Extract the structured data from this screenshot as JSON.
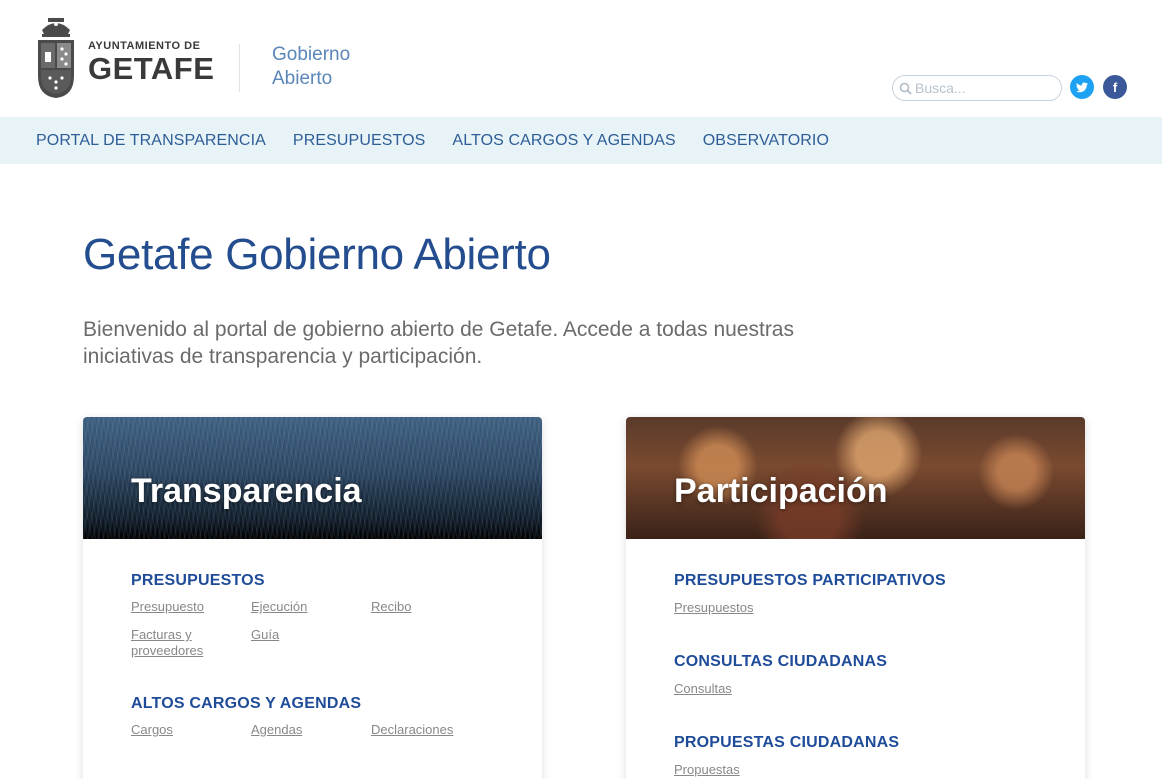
{
  "header": {
    "logo_small": "AYUNTAMIENTO DE",
    "logo_big": "GETAFE",
    "site_name_line1": "Gobierno",
    "site_name_line2": "Abierto",
    "search_placeholder": "Busca...",
    "twitter_glyph": "t",
    "facebook_glyph": "f"
  },
  "nav": {
    "items": [
      {
        "label": "PORTAL DE TRANSPARENCIA"
      },
      {
        "label": "PRESUPUESTOS"
      },
      {
        "label": "ALTOS CARGOS Y AGENDAS"
      },
      {
        "label": "OBSERVATORIO"
      }
    ]
  },
  "main": {
    "title": "Getafe Gobierno Abierto",
    "intro": "Bienvenido al portal de gobierno abierto de Getafe. Accede a todas nuestras iniciativas de transparencia y participación."
  },
  "cards": {
    "transparencia": {
      "title": "Transparencia",
      "sections": [
        {
          "title": "PRESUPUESTOS",
          "links": [
            "Presupuesto",
            "Ejecución",
            "Recibo",
            "Facturas y proveedores",
            "Guía"
          ]
        },
        {
          "title": "ALTOS CARGOS Y AGENDAS",
          "links": [
            "Cargos",
            "Agendas",
            "Declaraciones"
          ]
        }
      ]
    },
    "participacion": {
      "title": "Participación",
      "sections": [
        {
          "title": "PRESUPUESTOS PARTICIPATIVOS",
          "links": [
            "Presupuestos"
          ]
        },
        {
          "title": "CONSULTAS CIUDADANAS",
          "links": [
            "Consultas"
          ]
        },
        {
          "title": "PROPUESTAS CIUDADANAS",
          "links": [
            "Propuestas"
          ]
        }
      ]
    }
  },
  "colors": {
    "primary": "#234d8e",
    "nav_bg": "#e8f3f8",
    "twitter": "#1da1f2",
    "facebook": "#3b5998"
  }
}
